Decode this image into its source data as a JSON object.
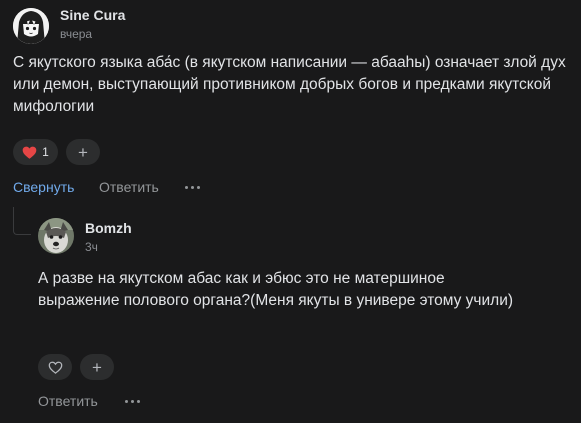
{
  "comment": {
    "author": "Sine Cura",
    "time": "вчера",
    "text": "С якутского языка аба́с (в якутском написании — абааhы) означает злой дух или демон, выступающий противником добрых богов и предками якутской мифологии",
    "reactions": {
      "heart_count": "1",
      "add_label": "+"
    },
    "actions": {
      "collapse": "Свернуть",
      "reply": "Ответить"
    },
    "colors": {
      "accent": "#71aaeb",
      "heart": "#e64646"
    }
  },
  "reply": {
    "author": "Bomzh",
    "time": "3ч",
    "text": "А разве на якутском абас как и эбюс это не матершиное выражение полового органа?(Меня якуты в универе этому учили)",
    "reactions": {
      "add_label": "+"
    },
    "actions": {
      "reply": "Ответить"
    }
  }
}
